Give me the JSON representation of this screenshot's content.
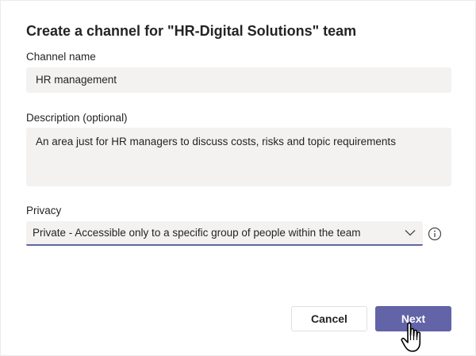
{
  "dialog": {
    "title": "Create a channel for \"HR-Digital Solutions\" team"
  },
  "channel_name": {
    "label": "Channel name",
    "value": "HR management"
  },
  "description": {
    "label": "Description (optional)",
    "value": "An area just for HR managers to discuss costs, risks and topic requirements"
  },
  "privacy": {
    "label": "Privacy",
    "selected": "Private - Accessible only to a specific group of people within the team",
    "icons": {
      "dropdown": "chevron-down-icon",
      "info": "info-icon"
    }
  },
  "buttons": {
    "cancel_label": "Cancel",
    "next_label": "Next"
  },
  "colors": {
    "accent": "#6264a7",
    "field_bg": "#f3f2f1",
    "text": "#252423"
  },
  "cursor": {
    "icon": "hand-pointer-icon"
  }
}
